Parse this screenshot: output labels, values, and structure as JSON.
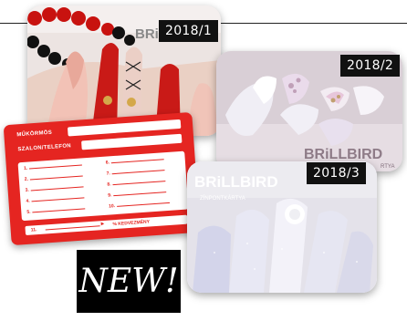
{
  "tags": {
    "first": "2018/1",
    "second": "2018/2",
    "third": "2018/3"
  },
  "brand": {
    "watermark_top": "BRi",
    "watermark_mid": "BRiLLBIRD",
    "watermark_bot": "BRiLLBIRD",
    "sub_mid": "RTYA",
    "sub_bot": "ZÍNPONTKÁRTYA"
  },
  "card": {
    "row1": "MŰKÖRMÖS",
    "row2": "SZALON/TELEFON",
    "items": [
      "1.",
      "2.",
      "3.",
      "4.",
      "5.",
      "6.",
      "7.",
      "8.",
      "9.",
      "10."
    ],
    "footer_num": "11.",
    "footer_text": "% KEDVEZMÉNY"
  },
  "badge": {
    "label": "NEW!"
  },
  "colors": {
    "card_red": "#e52521",
    "tag_bg": "#111111"
  }
}
